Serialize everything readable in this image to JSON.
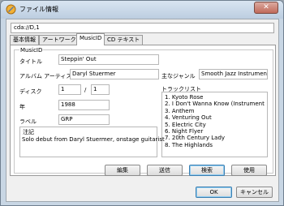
{
  "window": {
    "title": "ファイル情報",
    "close_label": "✕"
  },
  "path": "cda://D,1",
  "tabs": [
    {
      "label": "基本情報",
      "active": false
    },
    {
      "label": "アートワーク",
      "active": false
    },
    {
      "label": "MusicID",
      "active": true
    },
    {
      "label": "CD テキスト",
      "active": false
    }
  ],
  "musicid": {
    "group_label": "MusicID",
    "title_label": "タイトル",
    "title_value": "Steppin' Out",
    "artist_label": "アルバム アーティスト",
    "artist_value": "Daryl Stuermer",
    "genre_label": "主なジャンル",
    "genre_value": "Smooth Jazz Instrumental",
    "disc_label": "ディスク",
    "disc_number": "1",
    "disc_separator": "/",
    "disc_total": "1",
    "year_label": "年",
    "year_value": "1988",
    "label_label": "ラベル",
    "label_value": "GRP",
    "tracklist_label": "トラックリスト",
    "tracks": [
      "1. Kyoto Rose",
      "2. I Don't Wanna Know (Instrumental Versio",
      "3. Anthem",
      "4. Venturing Out",
      "5. Electric City",
      "6. Night Flyer",
      "7. 20th Century Lady",
      "8. The Highlands"
    ],
    "notes_label": "注記",
    "notes_value": "Solo debut from Daryl Stuermer, onstage guitarist"
  },
  "actions": {
    "edit": "編集",
    "send": "送信",
    "search": "検索",
    "use": "使用"
  },
  "footer": {
    "ok": "OK",
    "cancel": "キャンセル"
  },
  "colors": {
    "close_button": "#c06a5a",
    "focus_border": "#3c7fb1"
  }
}
